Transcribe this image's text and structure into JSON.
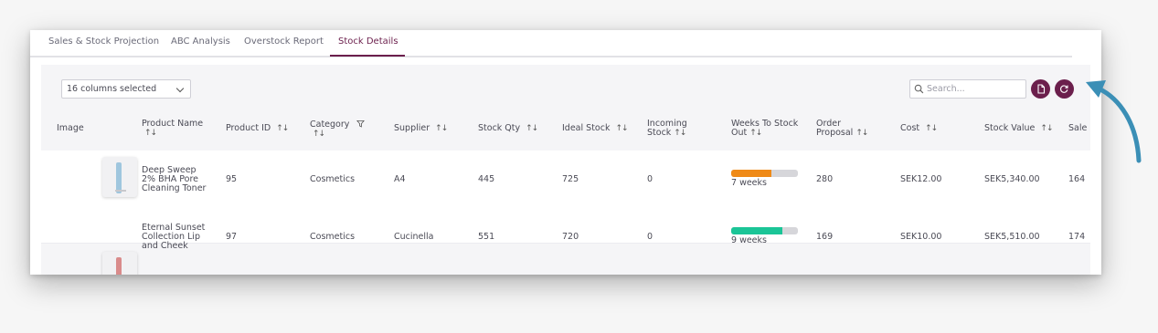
{
  "tabs": [
    {
      "label": "Sales & Stock Projection"
    },
    {
      "label": "ABC Analysis"
    },
    {
      "label": "Overstock Report"
    },
    {
      "label": "Stock Details",
      "active": true
    }
  ],
  "toolbar": {
    "columns_selected": "16 columns selected",
    "search_placeholder": "Search...",
    "export_icon": "document-icon",
    "refresh_icon": "refresh-icon",
    "button_color": "#6b1f4c"
  },
  "columns": {
    "image": "Image",
    "product_name": [
      "Product Name"
    ],
    "product_id": "Product ID",
    "category": "Category",
    "supplier": "Supplier",
    "stock_qty": "Stock Qty",
    "ideal_stock": "Ideal Stock",
    "incoming_stock": [
      "Incoming",
      "Stock"
    ],
    "weeks_to_stock_out": [
      "Weeks To Stock",
      "Out"
    ],
    "order_proposal": [
      "Order",
      "Proposal"
    ],
    "cost": "Cost",
    "stock_value": "Stock Value",
    "sales": "Sale"
  },
  "rows": [
    {
      "product_name": [
        "Deep Sweep",
        "2% BHA Pore",
        "Cleaning Toner"
      ],
      "product_id": "95",
      "category": "Cosmetics",
      "supplier": "A4",
      "stock_qty": "445",
      "ideal_stock": "725",
      "incoming_stock": "0",
      "weeks_label": "7 weeks",
      "weeks_fill": 0.6,
      "weeks_color": "#ef8a17",
      "order_proposal": "280",
      "cost": "SEK12.00",
      "stock_value": "SEK5,340.00",
      "sales": "164",
      "thumb_color": "#9fc6de"
    },
    {
      "product_name": [
        "Eternal Sunset",
        "Collection Lip",
        "and Cheek"
      ],
      "product_id": "97",
      "category": "Cosmetics",
      "supplier": "Cucinella",
      "stock_qty": "551",
      "ideal_stock": "720",
      "incoming_stock": "0",
      "weeks_label": "9 weeks",
      "weeks_fill": 0.77,
      "weeks_color": "#1bc597",
      "order_proposal": "169",
      "cost": "SEK10.00",
      "stock_value": "SEK5,510.00",
      "sales": "174",
      "thumb_color": "#d98b8b"
    }
  ],
  "annotation": {
    "arrow_color": "#3b8fb6"
  }
}
